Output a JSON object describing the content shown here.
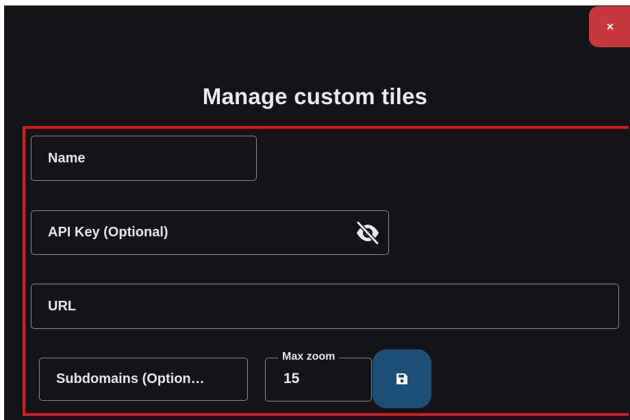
{
  "dialog": {
    "title": "Manage custom tiles",
    "close_label": "×",
    "close_color": "#c8373b",
    "highlight_color": "#e3141b"
  },
  "form": {
    "name_placeholder": "Name",
    "api_key_placeholder": "API Key (Optional)",
    "api_key_icon": "eye-slash-icon",
    "url_placeholder": "URL",
    "subdomains_placeholder": "Subdomains (Option…",
    "max_zoom_label": "Max zoom",
    "max_zoom_value": "15",
    "save_icon": "floppy-disk-icon",
    "save_color": "#1b4f7a"
  }
}
